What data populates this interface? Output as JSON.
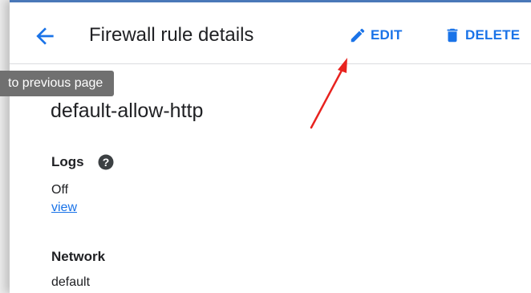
{
  "header": {
    "title": "Firewall rule details",
    "edit_label": "EDIT",
    "delete_label": "DELETE"
  },
  "tooltip": {
    "text": "to previous page"
  },
  "rule": {
    "name": "default-allow-http"
  },
  "logs": {
    "label": "Logs",
    "value": "Off",
    "link": "view"
  },
  "network": {
    "label": "Network",
    "value": "default"
  },
  "colors": {
    "accent": "#1a73e8",
    "annotation_arrow": "#e8231f",
    "tooltip_bg": "#707070"
  },
  "icons": {
    "back": "arrow-back-icon",
    "edit": "pencil-icon",
    "delete": "trash-icon",
    "help": "help-icon"
  }
}
